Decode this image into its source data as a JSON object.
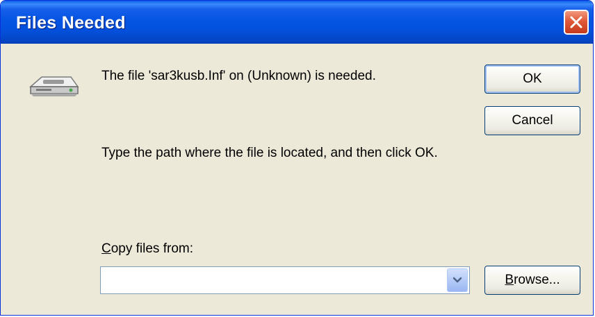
{
  "dialog": {
    "title": "Files Needed",
    "message_needed": "The file 'sar3kusb.Inf' on (Unknown) is needed.",
    "message_instructions": "Type the path where the file is located, and then click OK.",
    "copy_label_accel": "C",
    "copy_label_rest": "opy files from:",
    "copy_from_value": "",
    "buttons": {
      "ok": "OK",
      "cancel": "Cancel",
      "browse_accel": "B",
      "browse_rest": "rowse..."
    }
  },
  "icons": {
    "drive": "floppy-drive-icon",
    "close": "close-icon",
    "dropdown": "chevron-down-icon"
  },
  "colors": {
    "titlebar": "#0554e3",
    "close_button": "#e0593a",
    "dialog_background": "#ece9d8",
    "button_border": "#003c74"
  }
}
